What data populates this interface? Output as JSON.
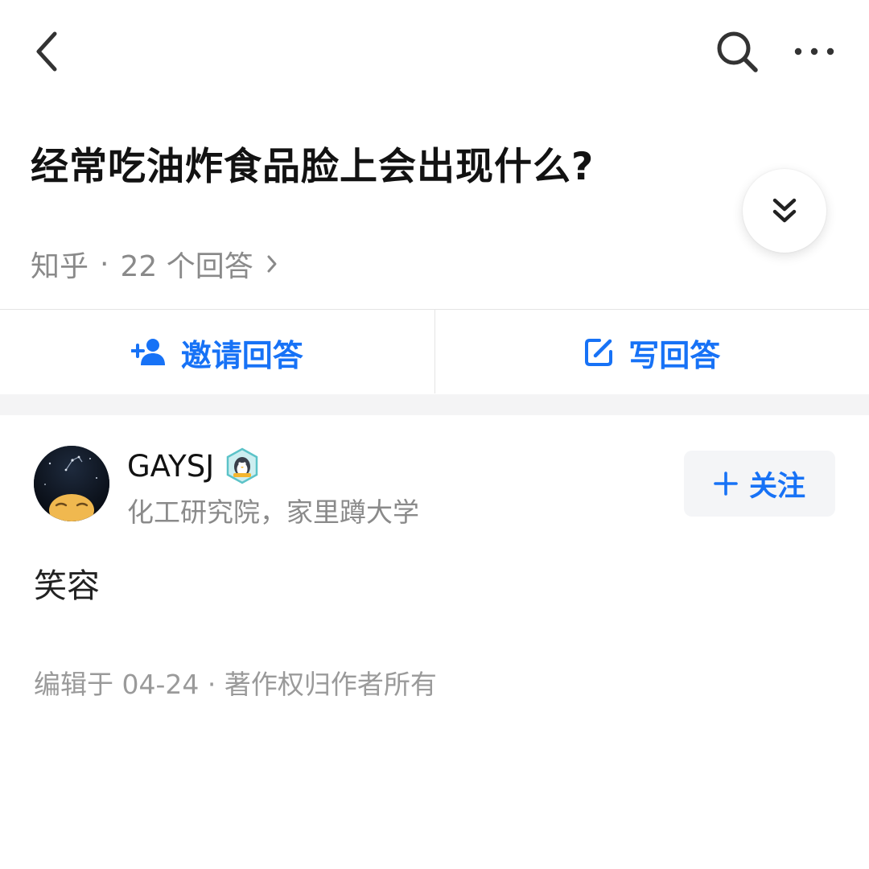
{
  "question": {
    "title": "经常吃油炸食品脸上会出现什么?",
    "source": "知乎",
    "separator": "·",
    "answer_count_text": "22 个回答"
  },
  "actions": {
    "invite_label": "邀请回答",
    "write_label": "写回答"
  },
  "answer": {
    "author_name": "GAYSJ",
    "author_bio": "化工研究院，家里蹲大学",
    "follow_label": "关注",
    "content": "笑容",
    "footer": "编辑于 04-24 · 著作权归作者所有"
  },
  "icons": {
    "back": "chevron-left-icon",
    "search": "search-icon",
    "more": "more-horizontal-icon",
    "expand": "double-chevron-down-icon",
    "invite": "person-add-icon",
    "write": "edit-icon",
    "follow": "plus-icon",
    "badge": "penguin-badge-icon"
  },
  "colors": {
    "accent": "#1772f6",
    "title": "#121212",
    "secondary": "#8a8a8a",
    "band": "#f4f4f5"
  }
}
